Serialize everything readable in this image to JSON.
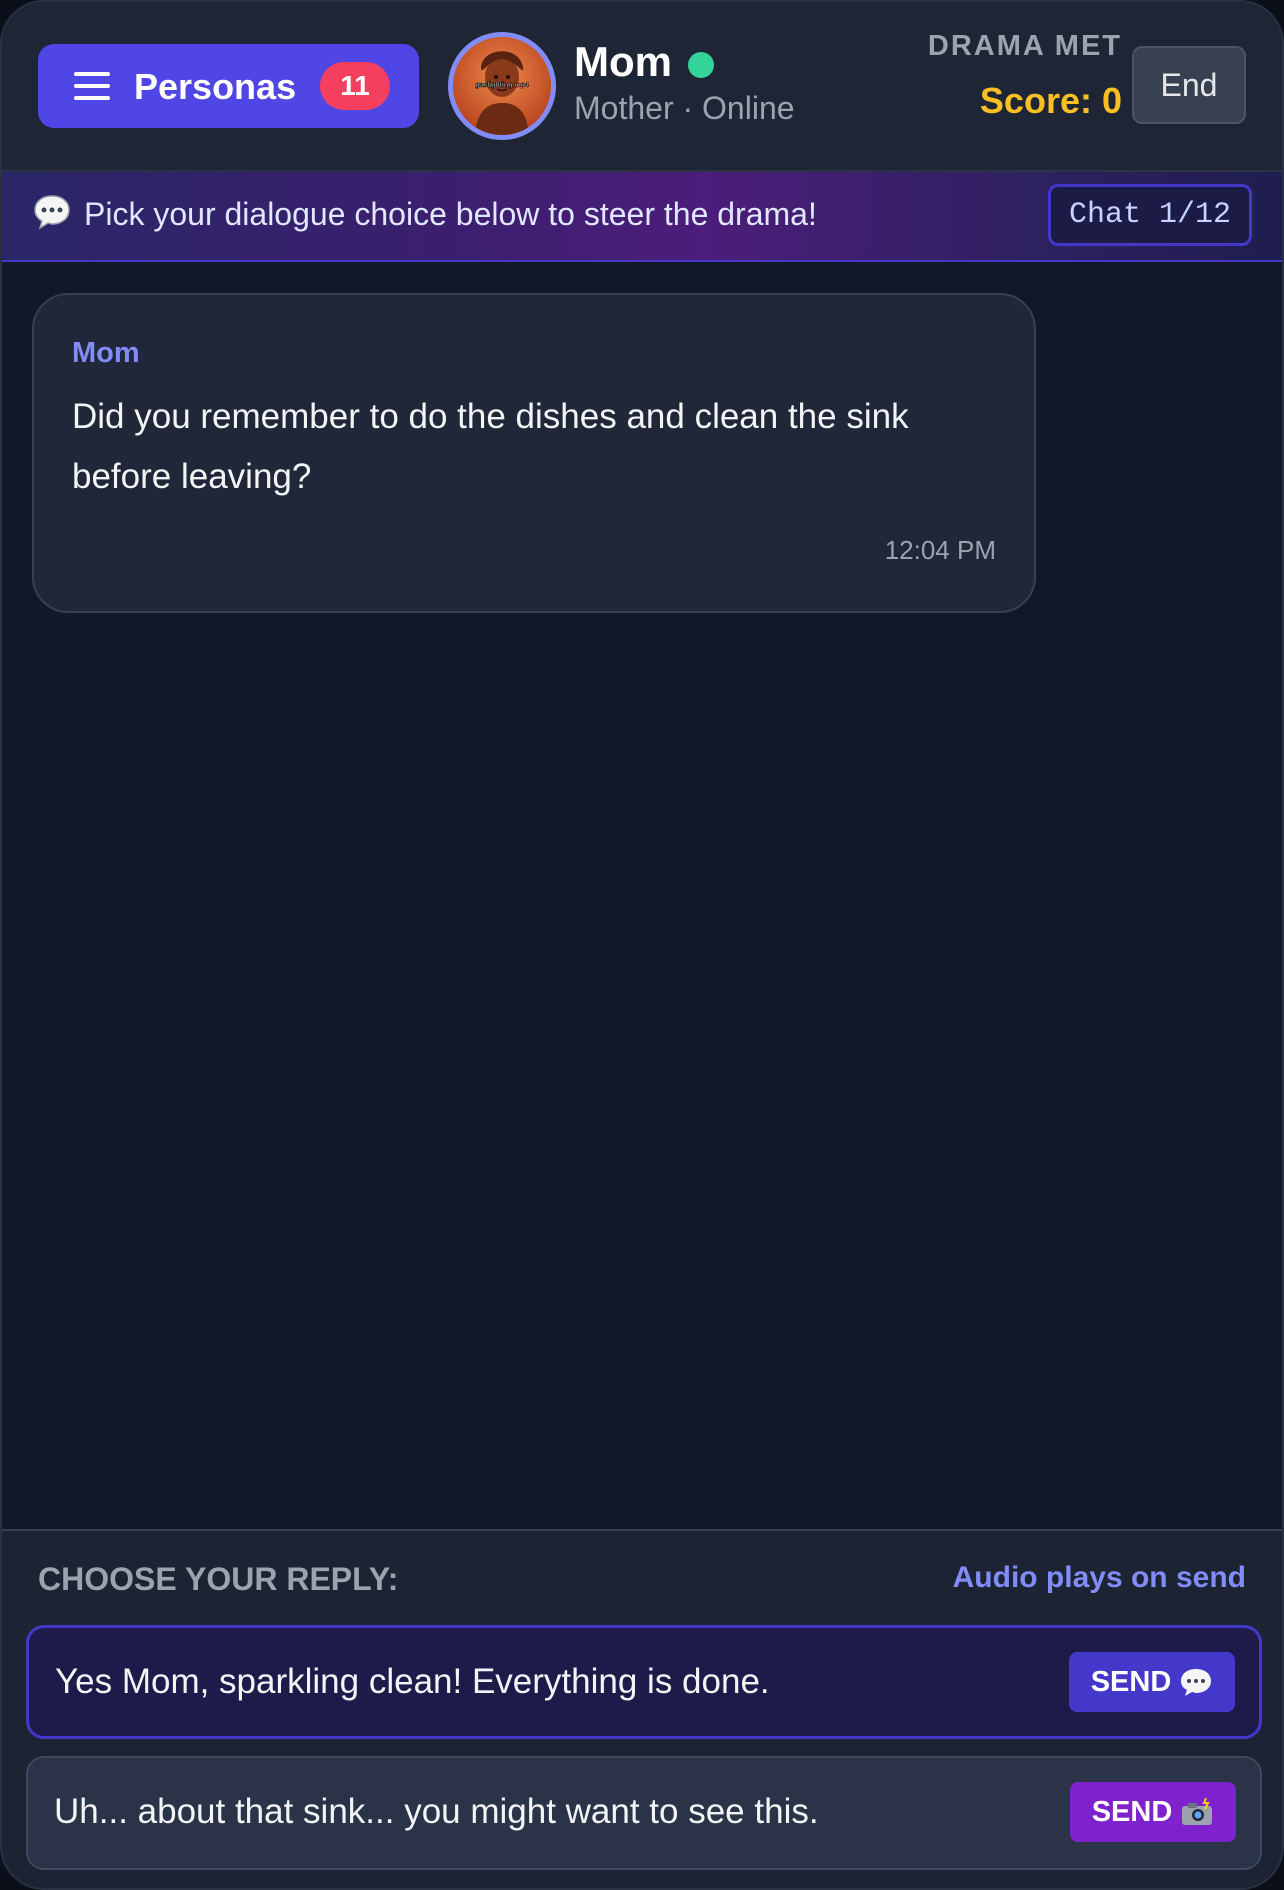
{
  "header": {
    "personas_label": "Personas",
    "personas_count": "11",
    "avatar_caption": "gaslighting.mp4",
    "contact_name": "Mom",
    "contact_subtitle": "Mother · Online",
    "drama_meter_label": "DRAMA MET",
    "score_text": "Score: 0",
    "end_label": "End"
  },
  "banner": {
    "icon": "speech-bubble-icon",
    "text": "Pick your dialogue choice below to steer the drama!",
    "chat_counter": "Chat 1/12"
  },
  "messages": [
    {
      "sender": "Mom",
      "text": "Did you remember to do the dishes and clean the sink before leaving?",
      "time": "12:04 PM"
    }
  ],
  "reply_panel": {
    "title": "CHOOSE YOUR REPLY:",
    "audio_note": "Audio plays on send",
    "choices": [
      {
        "text": "Yes Mom, sparkling clean! Everything is done.",
        "send_label": "SEND",
        "icon": "speech-bubble-icon"
      },
      {
        "text": "Uh... about that sink... you might want to see this.",
        "send_label": "SEND",
        "icon": "camera-flash-icon"
      }
    ]
  },
  "colors": {
    "accent": "#5046e5",
    "badge": "#f43f5e",
    "online": "#34d399",
    "score": "#fbbf24",
    "send_primary": "#4338ca",
    "send_secondary": "#7e22ce"
  }
}
